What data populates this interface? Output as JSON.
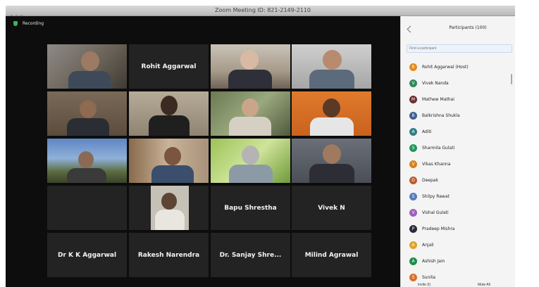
{
  "window": {
    "title": "Zoom Meeting ID: 821-2149-2110"
  },
  "meeting": {
    "label": "Recording"
  },
  "tiles": [
    {
      "name": "",
      "type": "video"
    },
    {
      "name": "Rohit Aggarwal",
      "type": "name"
    },
    {
      "name": "",
      "type": "video"
    },
    {
      "name": "",
      "type": "video"
    },
    {
      "name": "",
      "type": "video"
    },
    {
      "name": "",
      "type": "video"
    },
    {
      "name": "",
      "type": "video"
    },
    {
      "name": "",
      "type": "video"
    },
    {
      "name": "",
      "type": "video"
    },
    {
      "name": "",
      "type": "video"
    },
    {
      "name": "",
      "type": "video"
    },
    {
      "name": "",
      "type": "video"
    },
    {
      "name": "",
      "type": "name"
    },
    {
      "name": "",
      "type": "photo"
    },
    {
      "name": "Bapu Shrestha",
      "type": "name"
    },
    {
      "name": "Vivek N",
      "type": "name"
    },
    {
      "name": "Dr K K Aggarwal",
      "type": "name"
    },
    {
      "name": "Rakesh Narendra",
      "type": "name"
    },
    {
      "name": "Dr. Sanjay Shre...",
      "type": "name"
    },
    {
      "name": "Milind Agrawal",
      "type": "name"
    }
  ],
  "sidebar": {
    "title": "Participants (100)",
    "search_placeholder": "Find a participant",
    "participants": [
      {
        "name": "Rohit Aggarwal (Host)",
        "initial": "R",
        "color": "#e48a1a"
      },
      {
        "name": "Vivek Nanda",
        "initial": "V",
        "color": "#2e8b57"
      },
      {
        "name": "Mathew Mathai",
        "initial": "M",
        "color": "#6b2f2f"
      },
      {
        "name": "Balkrishna Shukla",
        "initial": "B",
        "color": "#3f5f95"
      },
      {
        "name": "Aditi",
        "initial": "A",
        "color": "#2f7f86"
      },
      {
        "name": "Sharmila Gulati",
        "initial": "S",
        "color": "#1c9a5a"
      },
      {
        "name": "Vikas Khanna",
        "initial": "V",
        "color": "#d6821c"
      },
      {
        "name": "Deepak",
        "initial": "D",
        "color": "#c05a2a"
      },
      {
        "name": "Shilpy Rawat",
        "initial": "S",
        "color": "#5a7bbd"
      },
      {
        "name": "Vishal Gulati",
        "initial": "V",
        "color": "#9b5fc0"
      },
      {
        "name": "Pradeep Mishra",
        "initial": "P",
        "color": "#2a2a3a"
      },
      {
        "name": "Anjali",
        "initial": "A",
        "color": "#e0a12c"
      },
      {
        "name": "Ashish Jain",
        "initial": "A",
        "color": "#1f8d4a"
      },
      {
        "name": "Sunita",
        "initial": "S",
        "color": "#d8702c"
      }
    ],
    "invite_label": "Invite (I)",
    "mute_all_label": "Mute All"
  },
  "colors": {
    "meeting_bg": "#0d0d0d",
    "tile_bg": "#232323",
    "sidebar_bg": "#f4f4f4"
  }
}
